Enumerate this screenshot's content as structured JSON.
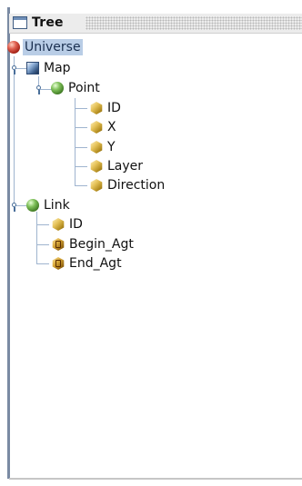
{
  "window": {
    "title": "Tree"
  },
  "tree": {
    "root": {
      "label": "Universe",
      "icon": "red-sphere-icon",
      "selected": true
    },
    "map": {
      "label": "Map",
      "icon": "blue-cube-icon"
    },
    "point": {
      "label": "Point",
      "icon": "green-sphere-icon"
    },
    "point_children": [
      {
        "label": "ID",
        "icon": "gold-hex-icon"
      },
      {
        "label": "X",
        "icon": "gold-hex-icon"
      },
      {
        "label": "Y",
        "icon": "gold-hex-icon"
      },
      {
        "label": "Layer",
        "icon": "gold-hex-icon"
      },
      {
        "label": "Direction",
        "icon": "gold-hex-icon"
      }
    ],
    "link": {
      "label": "Link",
      "icon": "green-sphere-icon"
    },
    "link_children": [
      {
        "label": "ID",
        "icon": "gold-hex-icon"
      },
      {
        "label": "Begin_Agt",
        "icon": "gold-key-icon"
      },
      {
        "label": "End_Agt",
        "icon": "gold-key-icon"
      }
    ]
  }
}
